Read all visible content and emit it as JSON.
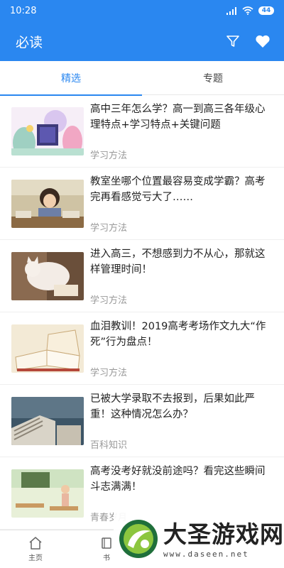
{
  "status_bar": {
    "time": "10:28",
    "battery": "44"
  },
  "header": {
    "title": "必读",
    "filter_icon": "filter-icon",
    "favorite_icon": "heart-icon"
  },
  "tabs": [
    {
      "label": "精选",
      "active": true
    },
    {
      "label": "专题",
      "active": false
    }
  ],
  "articles": [
    {
      "title": "高中三年怎么学？高一到高三各年级心理特点+学习特点+关键问题",
      "category": "学习方法"
    },
    {
      "title": "教室坐哪个位置最容易变成学霸？高考完再看感觉亏大了……",
      "category": "学习方法"
    },
    {
      "title": "进入高三，不想感到力不从心，那就这样管理时间！",
      "category": "学习方法"
    },
    {
      "title": "血泪教训！2019高考考场作文九大“作死”行为盘点！",
      "category": "学习方法"
    },
    {
      "title": "已被大学录取不去报到，后果如此严重！这种情况怎么办？",
      "category": "百科知识"
    },
    {
      "title": "高考没考好就没前途吗？看完这些瞬间斗志满满！",
      "category": "青春岁月"
    }
  ],
  "bottom_nav": [
    {
      "label": "主页",
      "icon": "home-icon"
    },
    {
      "label": "书",
      "icon": "book-icon"
    }
  ],
  "watermark": {
    "name": "大圣游戏网",
    "url": "www.daseen.net"
  },
  "colors": {
    "primary": "#2a87f0",
    "divider": "#efefef",
    "muted_text": "#999999"
  }
}
